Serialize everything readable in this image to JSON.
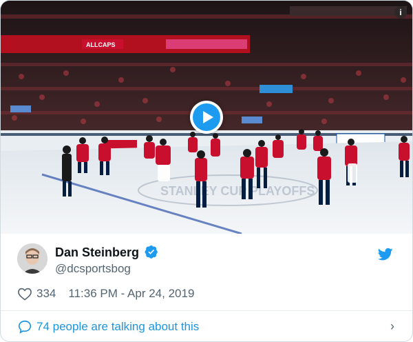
{
  "tweet": {
    "author_name": "Dan Steinberg",
    "author_handle": "@dcsportsbog",
    "like_count": "334",
    "timestamp": "11:36 PM - Apr 24, 2019",
    "conversation_text": "74 people are talking about this"
  },
  "media": {
    "arena_banner_text": "ALLCAPS",
    "ice_logo_text": "STANLEY CUP PLAYOFFS"
  },
  "icons": {
    "play": "play-icon",
    "info": "info-icon",
    "verified": "verified-badge-icon",
    "brand": "twitter-bird-icon",
    "like": "heart-icon",
    "reply": "speech-bubble-icon",
    "more": "chevron-right-icon"
  },
  "colors": {
    "accent": "#1d9bf0",
    "link": "#1b95e0",
    "secondary_text": "#536471",
    "caps_red": "#c8102e",
    "caps_navy": "#041e42"
  }
}
